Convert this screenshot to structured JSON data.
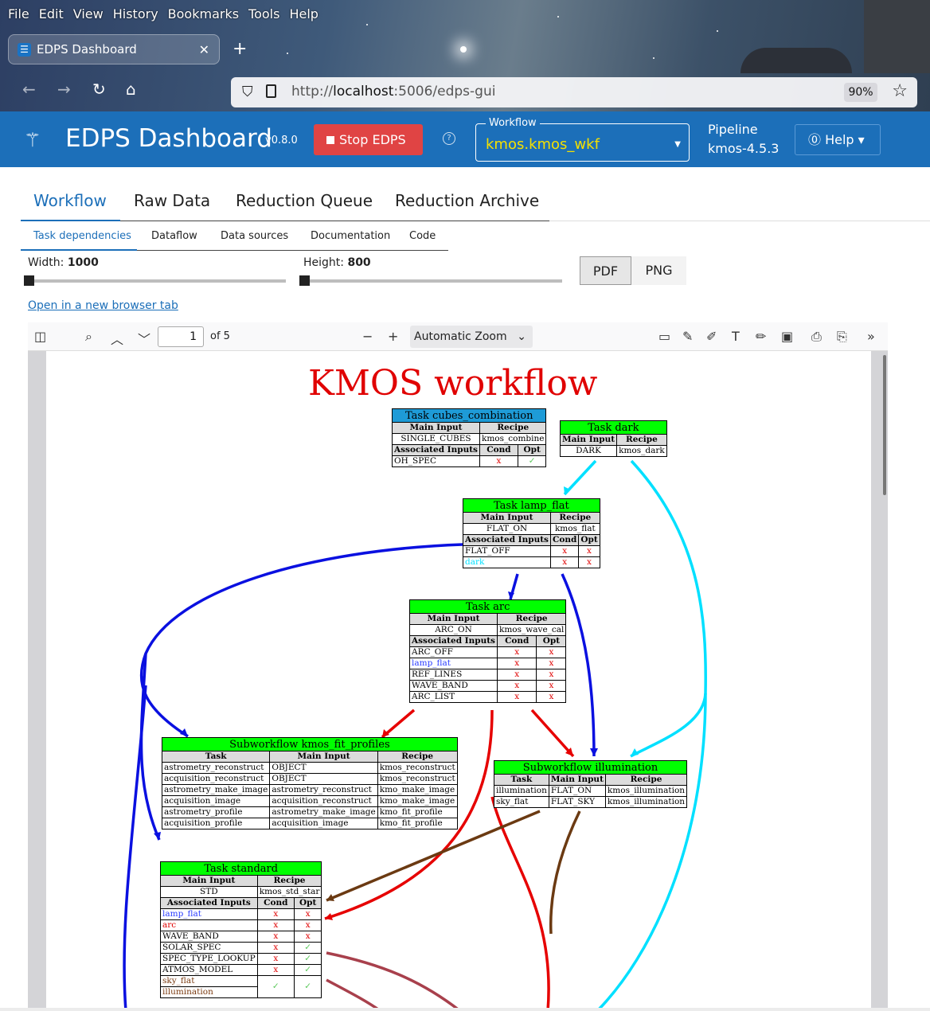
{
  "browser": {
    "menu": [
      "File",
      "Edit",
      "View",
      "History",
      "Bookmarks",
      "Tools",
      "Help"
    ],
    "tab_title": "EDPS Dashboard",
    "url_prefix": "http://",
    "url_host": "localhost",
    "url_rest": ":5006/edps-gui",
    "zoom": "90%"
  },
  "header": {
    "title": "EDPS Dashboard",
    "version": "v0.8.0",
    "stop_label": "Stop EDPS",
    "workflow_label": "Workflow",
    "workflow_value": "kmos.kmos_wkf",
    "pipeline_label": "Pipeline",
    "pipeline_value": "kmos-4.5.3",
    "help_label": "Help"
  },
  "main_tabs": [
    "Workflow",
    "Raw Data",
    "Reduction Queue",
    "Reduction Archive"
  ],
  "sub_tabs": [
    "Task dependencies",
    "Dataflow",
    "Data sources",
    "Documentation",
    "Code"
  ],
  "controls": {
    "width_label": "Width:",
    "width_value": "1000",
    "height_label": "Height:",
    "height_value": "800",
    "pdf_label": "PDF",
    "png_label": "PNG",
    "open_link": "Open in a new browser tab"
  },
  "pdf": {
    "page": "1",
    "of_pages": "of 5",
    "zoom": "Automatic Zoom"
  },
  "graph": {
    "title": "KMOS workflow",
    "cubes_combination": {
      "header": "Task cubes_combination",
      "main_input": "SINGLE_CUBES",
      "recipe": "kmos_combine",
      "assoc": [
        [
          "OH_SPEC",
          "x",
          "✓"
        ]
      ]
    },
    "dark": {
      "header": "Task dark",
      "main_input": "DARK",
      "recipe": "kmos_dark"
    },
    "lamp_flat": {
      "header": "Task lamp_flat",
      "main_input": "FLAT_ON",
      "recipe": "kmos_flat",
      "assoc": [
        [
          "FLAT_OFF",
          "x",
          "x"
        ],
        [
          "dark",
          "x",
          "x"
        ]
      ]
    },
    "arc": {
      "header": "Task arc",
      "main_input": "ARC_ON",
      "recipe": "kmos_wave_cal",
      "assoc": [
        [
          "ARC_OFF",
          "x",
          "x"
        ],
        [
          "lamp_flat",
          "x",
          "x"
        ],
        [
          "REF_LINES",
          "x",
          "x"
        ],
        [
          "WAVE_BAND",
          "x",
          "x"
        ],
        [
          "ARC_LIST",
          "x",
          "x"
        ]
      ]
    },
    "fit_profiles": {
      "header": "Subworkflow kmos_fit_profiles",
      "rows": [
        [
          "astrometry_reconstruct",
          "OBJECT",
          "kmos_reconstruct"
        ],
        [
          "acquisition_reconstruct",
          "OBJECT",
          "kmos_reconstruct"
        ],
        [
          "astrometry_make_image",
          "astrometry_reconstruct",
          "kmo_make_image"
        ],
        [
          "acquisition_image",
          "acquisition_reconstruct",
          "kmo_make_image"
        ],
        [
          "astrometry_profile",
          "astrometry_make_image",
          "kmo_fit_profile"
        ],
        [
          "acquisition_profile",
          "acquisition_image",
          "kmo_fit_profile"
        ]
      ]
    },
    "illumination": {
      "header": "Subworkflow illumination",
      "rows": [
        [
          "illumination",
          "FLAT_ON",
          "kmos_illumination"
        ],
        [
          "sky_flat",
          "FLAT_SKY",
          "kmos_illumination"
        ]
      ]
    },
    "standard": {
      "header": "Task standard",
      "main_input": "STD",
      "recipe": "kmos_std_star",
      "assoc": [
        [
          "lamp_flat",
          "x",
          "x"
        ],
        [
          "arc",
          "x",
          "x"
        ],
        [
          "WAVE_BAND",
          "x",
          "x"
        ],
        [
          "SOLAR_SPEC",
          "x",
          "✓"
        ],
        [
          "SPEC_TYPE_LOOKUP",
          "x",
          "✓"
        ],
        [
          "ATMOS_MODEL",
          "x",
          "✓"
        ],
        [
          "sky_flat",
          "✓",
          "✓"
        ],
        [
          "illumination",
          "",
          ""
        ]
      ]
    },
    "col": {
      "main_input": "Main Input",
      "recipe": "Recipe",
      "assoc": "Associated Inputs",
      "cond": "Cond",
      "opt": "Opt",
      "task": "Task"
    }
  }
}
